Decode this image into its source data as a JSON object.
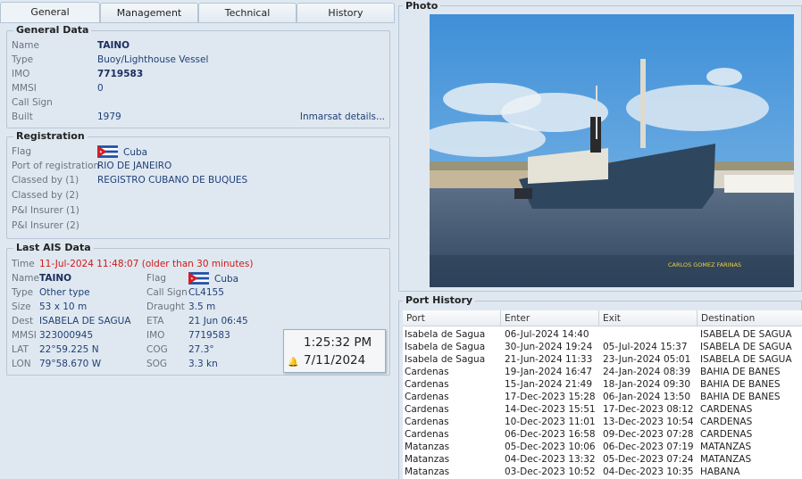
{
  "tabs": [
    {
      "label": "General"
    },
    {
      "label": "Management"
    },
    {
      "label": "Technical"
    },
    {
      "label": "History"
    }
  ],
  "general": {
    "title": "General Data",
    "name_label": "Name",
    "name": "TAINO",
    "type_label": "Type",
    "type": "Buoy/Lighthouse Vessel",
    "imo_label": "IMO",
    "imo": "7719583",
    "mmsi_label": "MMSI",
    "mmsi": "0",
    "callsign_label": "Call Sign",
    "callsign": "",
    "built_label": "Built",
    "built": "1979",
    "inmarsat_link": "Inmarsat details..."
  },
  "registration": {
    "title": "Registration",
    "flag_label": "Flag",
    "flag": "Cuba",
    "port_label": "Port of registration",
    "port": "RIO DE JANEIRO",
    "classed1_label": "Classed by (1)",
    "classed1": "REGISTRO CUBANO DE BUQUES",
    "classed2_label": "Classed by (2)",
    "classed2": "",
    "pi1_label": "P&I Insurer (1)",
    "pi1": "",
    "pi2_label": "P&I Insurer (2)",
    "pi2": ""
  },
  "ais": {
    "title": "Last AIS Data",
    "time_label": "Time",
    "time": "11-Jul-2024 11:48:07 (older than 30 minutes)",
    "name_label": "Name",
    "name": "TAINO",
    "flag_label": "Flag",
    "flag": "Cuba",
    "type_label": "Type",
    "type": "Other type",
    "callsign_label": "Call Sign",
    "callsign": "CL4155",
    "size_label": "Size",
    "size": "53 x 10 m",
    "draught_label": "Draught",
    "draught": "3.5 m",
    "dest_label": "Dest",
    "dest": "ISABELA DE SAGUA",
    "eta_label": "ETA",
    "eta": "21 Jun 06:45",
    "mmsi_label": "MMSI",
    "mmsi": "323000945",
    "imo_label": "IMO",
    "imo": "7719583",
    "lat_label": "LAT",
    "lat": "22°59.225 N",
    "cog_label": "COG",
    "cog": "27.3°",
    "lon_label": "LON",
    "lon": "79°58.670 W",
    "sog_label": "SOG",
    "sog": "3.3 kn"
  },
  "photo": {
    "title": "Photo",
    "credit": "CARLOS GOMEZ FARINAS"
  },
  "port_history": {
    "title": "Port History",
    "columns": [
      "Port",
      "Enter",
      "Exit",
      "Destination"
    ],
    "rows": [
      [
        "Isabela de Sagua",
        "06-Jul-2024 14:40",
        "",
        "ISABELA DE SAGUA"
      ],
      [
        "Isabela de Sagua",
        "30-Jun-2024 19:24",
        "05-Jul-2024 15:37",
        "ISABELA DE SAGUA"
      ],
      [
        "Isabela de Sagua",
        "21-Jun-2024 11:33",
        "23-Jun-2024 05:01",
        "ISABELA DE SAGUA"
      ],
      [
        "Cardenas",
        "19-Jan-2024 16:47",
        "24-Jan-2024 08:39",
        "BAHIA DE BANES"
      ],
      [
        "Cardenas",
        "15-Jan-2024 21:49",
        "18-Jan-2024 09:30",
        "BAHIA DE BANES"
      ],
      [
        "Cardenas",
        "17-Dec-2023 15:28",
        "06-Jan-2024 13:50",
        "BAHIA DE BANES"
      ],
      [
        "Cardenas",
        "14-Dec-2023 15:51",
        "17-Dec-2023 08:12",
        "CARDENAS"
      ],
      [
        "Cardenas",
        "10-Dec-2023 11:01",
        "13-Dec-2023 10:54",
        "CARDENAS"
      ],
      [
        "Cardenas",
        "06-Dec-2023 16:58",
        "09-Dec-2023 07:28",
        "CARDENAS"
      ],
      [
        "Matanzas",
        "05-Dec-2023 10:06",
        "06-Dec-2023 07:19",
        "MATANZAS"
      ],
      [
        "Matanzas",
        "04-Dec-2023 13:32",
        "05-Dec-2023 07:24",
        "MATANZAS"
      ],
      [
        "Matanzas",
        "03-Dec-2023 10:52",
        "04-Dec-2023 10:35",
        "HABANA"
      ]
    ]
  },
  "clock": {
    "time": "1:25:32 PM",
    "date": "7/11/2024"
  },
  "colors": {
    "value_blue": "#1f3f78",
    "warning_red": "#d01818",
    "panel_bg": "#dfe8f0"
  }
}
